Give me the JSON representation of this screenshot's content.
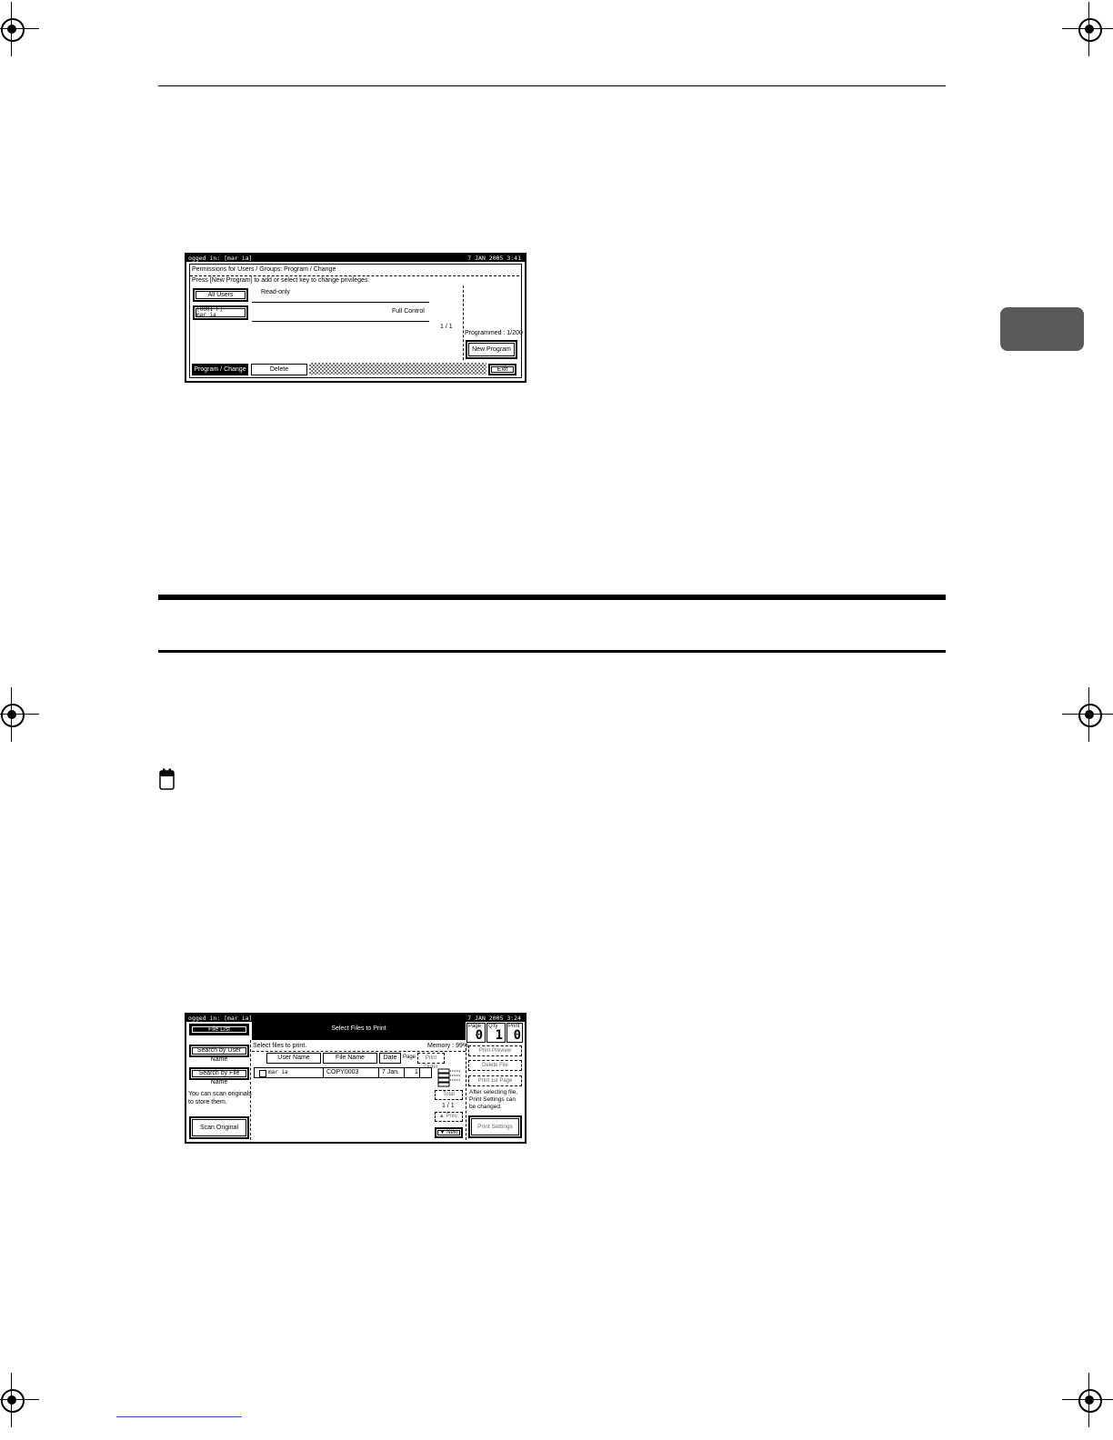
{
  "screen1": {
    "status_left": "ogged in: [mar ia]",
    "status_right": "7 JAN 2005 3:41",
    "title": "Permissions for Users / Groups: Program / Change",
    "instruction": "Press [New Program] to add or select key to change privileges.",
    "all_users_label": "All Users",
    "user_entry_id": "[0001 F]",
    "user_entry_name": "mar ia",
    "read_only_label": "Read-only",
    "full_control_label": "Full Control",
    "page_indicator": "1 / 1",
    "programmed_label": "Programmed :  1/200",
    "new_program_label": "New Program",
    "tab_program_change": "Program / Change",
    "tab_delete": "Delete",
    "exit_label": "Exit"
  },
  "screen2": {
    "status_left": "ogged in: [mar ia]",
    "status_right": "7 JAN 2005 3:24",
    "file_list_label": "File List",
    "title": "Select Files to Print",
    "page_label": "Page",
    "qty_label": "Q'ty",
    "print_label": "Print",
    "page_value": "0",
    "qty_value": "1",
    "print_value": "0",
    "select_prompt": "Select files to print.",
    "memory_label": "Memory :  99%",
    "search_user_label": "Search by User Name",
    "search_file_label": "Search by File Name",
    "col_user_name": "User Name",
    "col_file_name": "File Name",
    "col_date": "Date",
    "col_page": "Page",
    "col_print_order": "Print Order",
    "row_user": "mar ia",
    "row_file": "COPY0003",
    "row_date": "7 Jan.",
    "row_page": "1",
    "print_preview_label": "Print Preview",
    "delete_file_label": "Delete File",
    "print_1st_page_label": "Print 1st Page",
    "after_selecting_text_1": "After selecting file,",
    "after_selecting_text_2": "Print Settings can",
    "after_selecting_text_3": "be changed.",
    "scan_hint_1": "You can scan originals",
    "scan_hint_2": "to store them.",
    "scan_original_label": "Scan Original",
    "total_label": "Total",
    "page_indicator": "1 / 1",
    "prev_label": "▲ Prev.",
    "next_label": "▼ Next",
    "print_settings_label": "Print Settings"
  }
}
